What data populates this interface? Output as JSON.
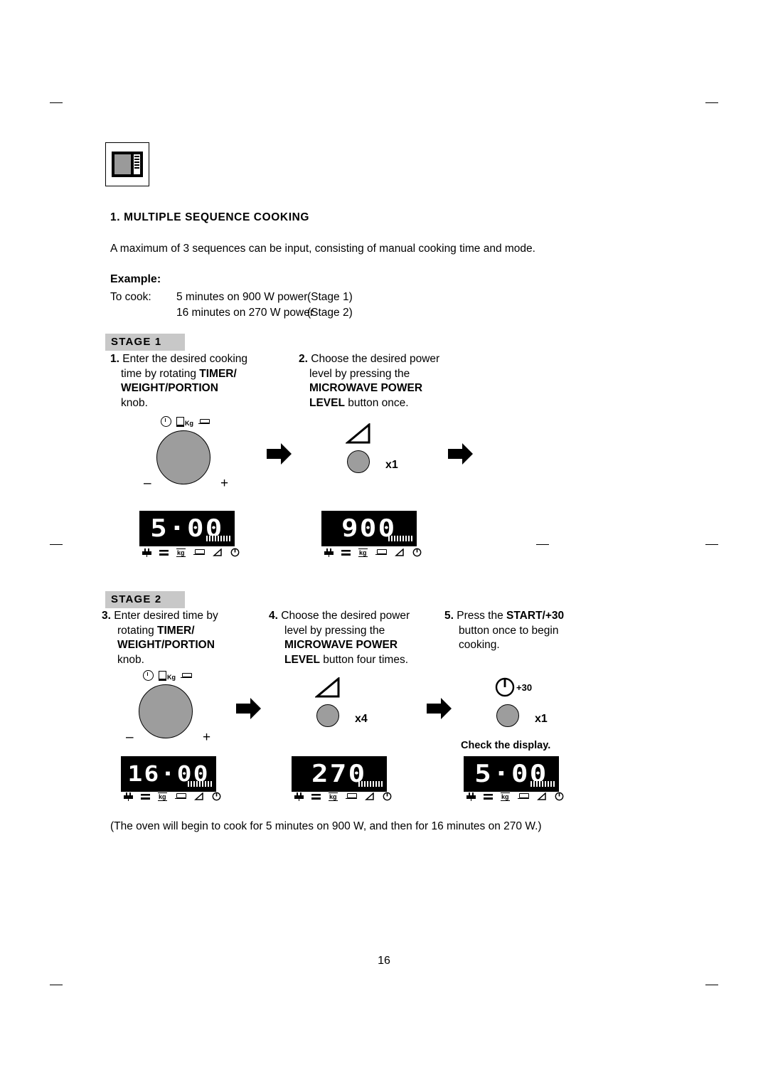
{
  "page": {
    "number": "16",
    "section_number": "1.",
    "section_title": "MULTIPLE SEQUENCE COOKING",
    "intro": "A maximum of 3 sequences can be input, consisting of manual cooking time and mode.",
    "example_label": "Example:",
    "to_cook_label": "To cook:",
    "to_cook_line1": "5 minutes on 900 W power",
    "to_cook_stage1": "(Stage 1)",
    "to_cook_line2": "16 minutes on 270 W power",
    "to_cook_stage2": "(Stage 2)",
    "closing_note": "(The oven will begin to cook for 5 minutes on 900 W, and then for 16 minutes on 270 W.)"
  },
  "stage1": {
    "bar_label": "STAGE  1",
    "step1": {
      "num": "1.",
      "line1": "Enter the desired cooking",
      "line2_pre": "time by rotating ",
      "line2_bold": "TIMER/",
      "line3_bold": "WEIGHT/PORTION",
      "line4": "knob.",
      "knob_minus": "–",
      "knob_plus": "+",
      "display": "5·00"
    },
    "step2": {
      "num": "2.",
      "line1": "Choose the desired power",
      "line2": "level by pressing the",
      "line3_bold": "MICROWAVE POWER",
      "line4_bold": "LEVEL",
      "line4_rest": " button once.",
      "press_count": "x1",
      "display": "900"
    }
  },
  "stage2": {
    "bar_label": "STAGE  2",
    "step3": {
      "num": "3.",
      "line1": "Enter desired time by",
      "line2_pre": "rotating ",
      "line2_bold": "TIMER/",
      "line3_bold": "WEIGHT/PORTION",
      "line4": "knob.",
      "knob_minus": "–",
      "knob_plus": "+",
      "display": "16·00"
    },
    "step4": {
      "num": "4.",
      "line1": "Choose the desired power",
      "line2": "level by pressing the",
      "line3_bold": "MICROWAVE POWER",
      "line4_bold": "LEVEL",
      "line4_rest": " button four times.",
      "press_count": "x4",
      "display": "270"
    },
    "step5": {
      "num": "5.",
      "line1_pre": "Press the ",
      "line1_bold": "START/+30",
      "line2": "button once to begin",
      "line3": "cooking.",
      "press_count": "x1",
      "check_display": "Check the display.",
      "start_label": "+30",
      "display": "5·00"
    }
  },
  "icons": {
    "microwave": "microwave-oven-icon",
    "clock": "clock-icon",
    "kg": "Kg",
    "plate": "plate-icon",
    "power_triangle": "power-level-triangle-icon",
    "arrow": "arrow-right-icon"
  }
}
